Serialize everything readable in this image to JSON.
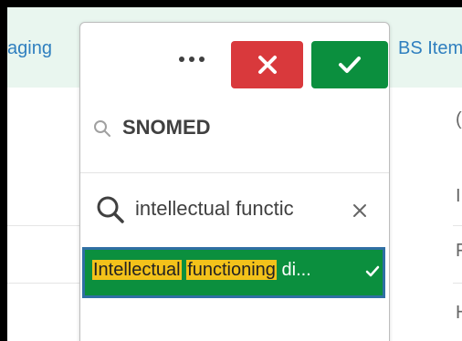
{
  "background": {
    "left_tab_label": "aging",
    "right_tab_label": "BS Item"
  },
  "colors": {
    "cancel": "#d9393c",
    "confirm": "#0b8f3e",
    "highlight": "#f3c21a",
    "header_bg": "#e9f6ef",
    "tab_text": "#2f7fbf"
  },
  "popup": {
    "toolbar": {
      "more_label": "…",
      "cancel_icon": "close-icon",
      "confirm_icon": "check-icon"
    },
    "title": "SNOMED",
    "search": {
      "value": "intellectual functic",
      "placeholder": ""
    },
    "result": {
      "part1": "Intellectual",
      "part2": "functioning",
      "rest": "di...",
      "selected": true
    }
  }
}
